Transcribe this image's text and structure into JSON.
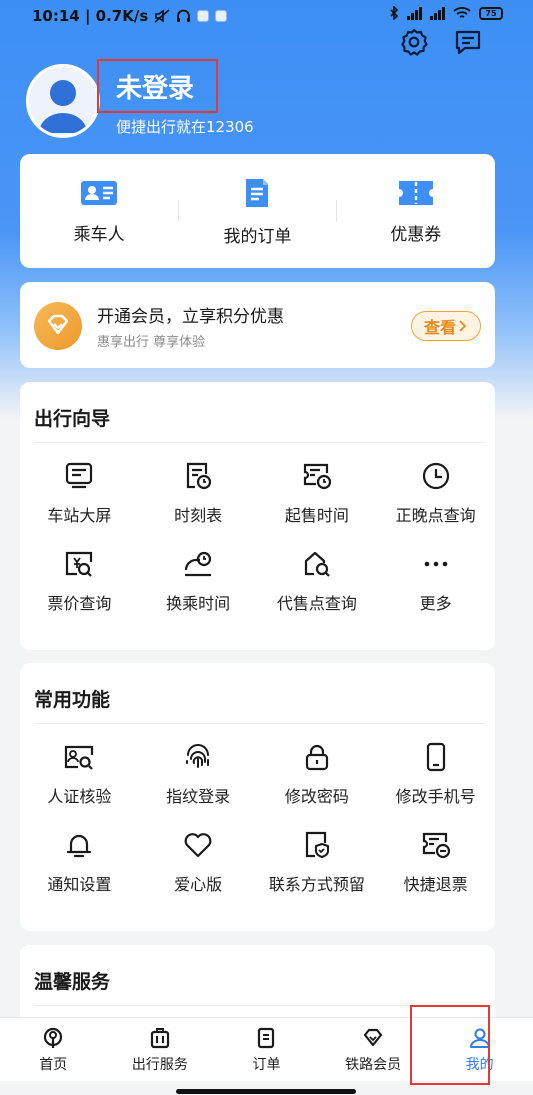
{
  "status_bar": {
    "left_text": "10:14 | 0.7K/s",
    "battery": "75"
  },
  "header": {
    "settings_icon": "gear-icon",
    "messages_icon": "message-icon"
  },
  "profile": {
    "name": "未登录",
    "slogan": "便捷出行就在12306"
  },
  "quick_actions": [
    {
      "label": "乘车人",
      "icon": "passenger-card-icon"
    },
    {
      "label": "我的订单",
      "icon": "order-doc-icon"
    },
    {
      "label": "优惠券",
      "icon": "coupon-icon"
    }
  ],
  "member": {
    "title": "开通会员，立享积分优惠",
    "subtitle": "惠享出行 尊享体验",
    "button": "查看"
  },
  "guide": {
    "title": "出行向导",
    "items": [
      {
        "label": "车站大屏",
        "icon": "station-screen-icon"
      },
      {
        "label": "时刻表",
        "icon": "timetable-icon"
      },
      {
        "label": "起售时间",
        "icon": "sale-time-icon"
      },
      {
        "label": "正晚点查询",
        "icon": "clock-icon"
      },
      {
        "label": "票价查询",
        "icon": "fare-search-icon"
      },
      {
        "label": "换乘时间",
        "icon": "transfer-time-icon"
      },
      {
        "label": "代售点查询",
        "icon": "agency-search-icon"
      },
      {
        "label": "更多",
        "icon": "more-icon"
      }
    ]
  },
  "common": {
    "title": "常用功能",
    "items": [
      {
        "label": "人证核验",
        "icon": "id-verify-icon"
      },
      {
        "label": "指纹登录",
        "icon": "fingerprint-icon"
      },
      {
        "label": "修改密码",
        "icon": "lock-icon"
      },
      {
        "label": "修改手机号",
        "icon": "phone-icon"
      },
      {
        "label": "通知设置",
        "icon": "bell-icon"
      },
      {
        "label": "爱心版",
        "icon": "heart-icon"
      },
      {
        "label": "联系方式预留",
        "icon": "contact-shield-icon"
      },
      {
        "label": "快捷退票",
        "icon": "refund-ticket-icon"
      }
    ]
  },
  "warm": {
    "title": "温馨服务"
  },
  "bottom_nav": [
    {
      "label": "首页",
      "icon": "home-icon",
      "active": false
    },
    {
      "label": "出行服务",
      "icon": "luggage-icon",
      "active": false
    },
    {
      "label": "订单",
      "icon": "order-icon",
      "active": false
    },
    {
      "label": "铁路会员",
      "icon": "diamond-icon",
      "active": false
    },
    {
      "label": "我的",
      "icon": "person-icon",
      "active": true
    }
  ],
  "colors": {
    "brand_blue": "#3d8ff5",
    "accent_orange": "#f2a33a",
    "active_nav": "#2f7ef3",
    "highlight_box": "#e53935"
  }
}
